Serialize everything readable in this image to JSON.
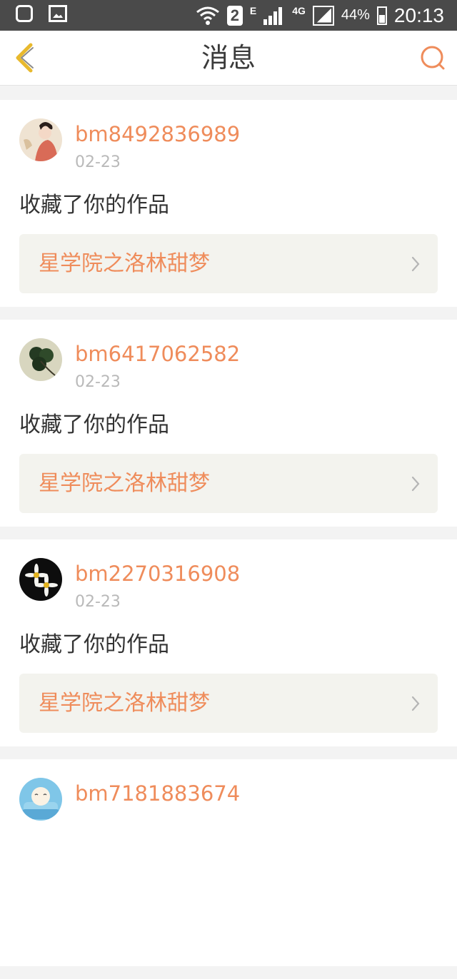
{
  "status_bar": {
    "network_badge": "2",
    "edge_label": "E",
    "lte_label": "4G",
    "battery_percent": "44%",
    "time": "20:13"
  },
  "header": {
    "title": "消息",
    "back_icon": "chevron-left-icon",
    "search_icon": "search-icon"
  },
  "colors": {
    "accent": "#ef8c5b",
    "back_icon": "#e8b92d",
    "status_bar": "#4a4a4a"
  },
  "messages": [
    {
      "username": "bm8492836989",
      "date": "02-23",
      "action": "收藏了你的作品",
      "work_title": "星学院之洛林甜梦",
      "avatar": "lady-portrait"
    },
    {
      "username": "bm6417062582",
      "date": "02-23",
      "action": "收藏了你的作品",
      "work_title": "星学院之洛林甜梦",
      "avatar": "clover"
    },
    {
      "username": "bm2270316908",
      "date": "02-23",
      "action": "收藏了你的作品",
      "work_title": "星学院之洛林甜梦",
      "avatar": "daisies"
    },
    {
      "username": "bm7181883674",
      "date": "",
      "action": "",
      "work_title": "",
      "avatar": "cartoon-sleeper"
    }
  ]
}
